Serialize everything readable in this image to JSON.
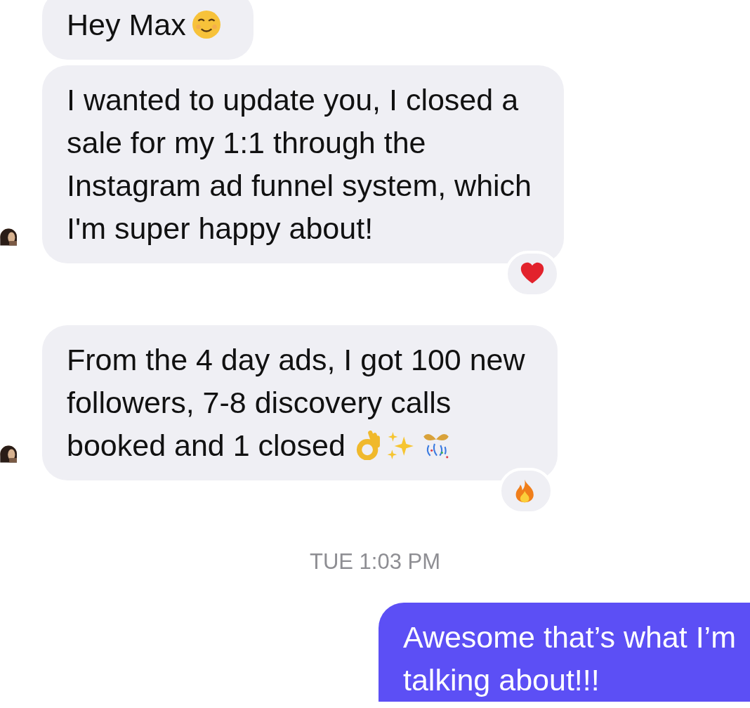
{
  "messages": [
    {
      "kind": "incoming",
      "avatar": false,
      "lines": [
        "Hey Max"
      ],
      "emoji": [
        {
          "kind": "smiling-face"
        }
      ]
    },
    {
      "kind": "incoming",
      "avatar": true,
      "lines": [
        "I wanted to update you, I closed a",
        "sale for my 1:1 through the",
        "Instagram ad funnel system, which",
        "I'm super happy about!"
      ],
      "reaction": {
        "kind": "heart"
      }
    },
    {
      "kind": "incoming",
      "avatar": true,
      "lines": [
        "From the 4 day ads, I got 100 new",
        "followers, 7-8 discovery calls",
        "booked and 1 closed"
      ],
      "emoji": [
        {
          "kind": "ok-hand"
        },
        {
          "kind": "sparkles"
        },
        {
          "kind": "party-popper"
        }
      ],
      "reaction": {
        "kind": "fire"
      }
    },
    {
      "kind": "timestamp",
      "text": "TUE 1:03 PM"
    },
    {
      "kind": "outgoing",
      "lines": [
        "Awesome that’s what I’m",
        "talking about!!!"
      ]
    }
  ]
}
